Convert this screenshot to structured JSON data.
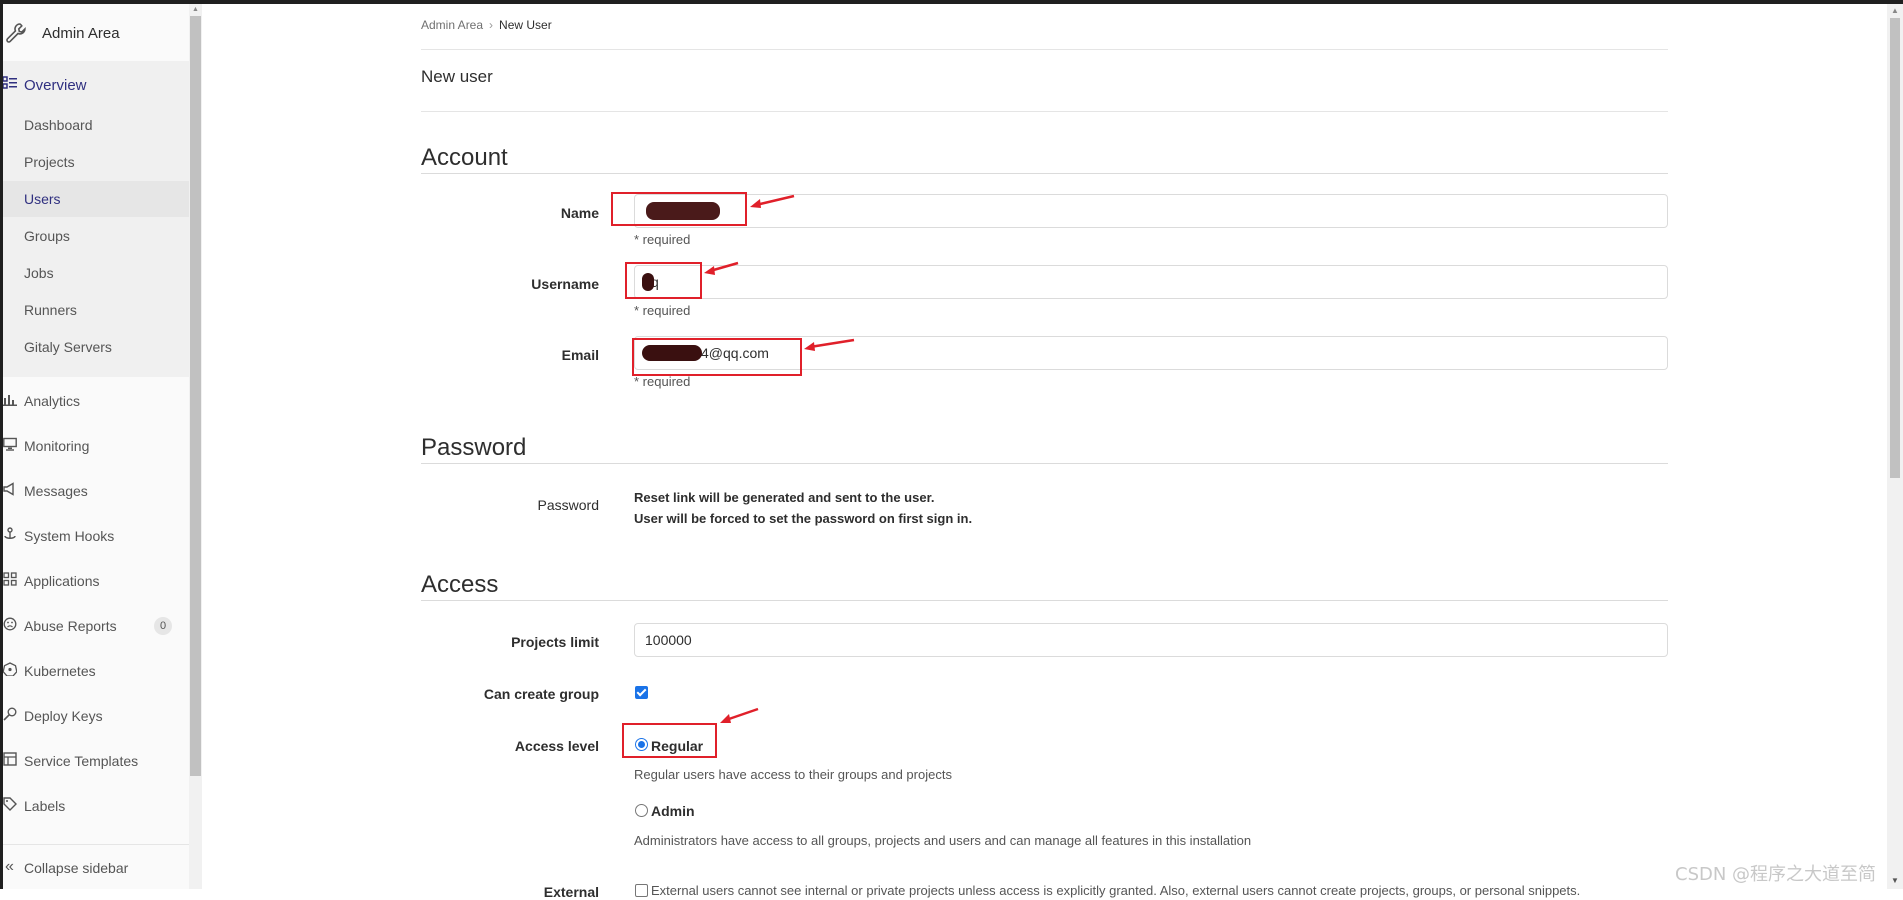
{
  "sidebar": {
    "header_title": "Admin Area",
    "overview_label": "Overview",
    "overview_items": [
      "Dashboard",
      "Projects",
      "Users",
      "Groups",
      "Jobs",
      "Runners",
      "Gitaly Servers"
    ],
    "items": [
      {
        "label": "Analytics",
        "icon": "chart-icon"
      },
      {
        "label": "Monitoring",
        "icon": "monitor-icon"
      },
      {
        "label": "Messages",
        "icon": "megaphone-icon"
      },
      {
        "label": "System Hooks",
        "icon": "hook-icon"
      },
      {
        "label": "Applications",
        "icon": "grid-icon"
      },
      {
        "label": "Abuse Reports",
        "icon": "face-icon",
        "badge": "0"
      },
      {
        "label": "Kubernetes",
        "icon": "kubernetes-icon"
      },
      {
        "label": "Deploy Keys",
        "icon": "key-icon"
      },
      {
        "label": "Service Templates",
        "icon": "template-icon"
      },
      {
        "label": "Labels",
        "icon": "label-icon"
      }
    ],
    "collapse_label": "Collapse sidebar"
  },
  "breadcrumb": {
    "parent": "Admin Area",
    "separator": "›",
    "current": "New User"
  },
  "page_title": "New user",
  "account": {
    "heading": "Account",
    "name_label": "Name",
    "name_value": "n",
    "username_label": "Username",
    "username_value": "q",
    "email_label": "Email",
    "email_value": "4@qq.com",
    "required_text": "* required"
  },
  "password": {
    "heading": "Password",
    "label": "Password",
    "line1": "Reset link will be generated and sent to the user.",
    "line2": "User will be forced to set the password on first sign in."
  },
  "access": {
    "heading": "Access",
    "projects_limit_label": "Projects limit",
    "projects_limit_value": "100000",
    "can_create_group_label": "Can create group",
    "can_create_group_checked": true,
    "access_level_label": "Access level",
    "regular_label": "Regular",
    "regular_help": "Regular users have access to their groups and projects",
    "admin_label": "Admin",
    "admin_help": "Administrators have access to all groups, projects and users and can manage all features in this installation",
    "external_label": "External",
    "external_help": "External users cannot see internal or private projects unless access is explicitly granted. Also, external users cannot create projects, groups, or personal snippets."
  },
  "watermark": "CSDN @程序之大道至简",
  "colors": {
    "accent": "#1a73e8",
    "annotation": "#e0202a",
    "active_nav": "#303080"
  }
}
